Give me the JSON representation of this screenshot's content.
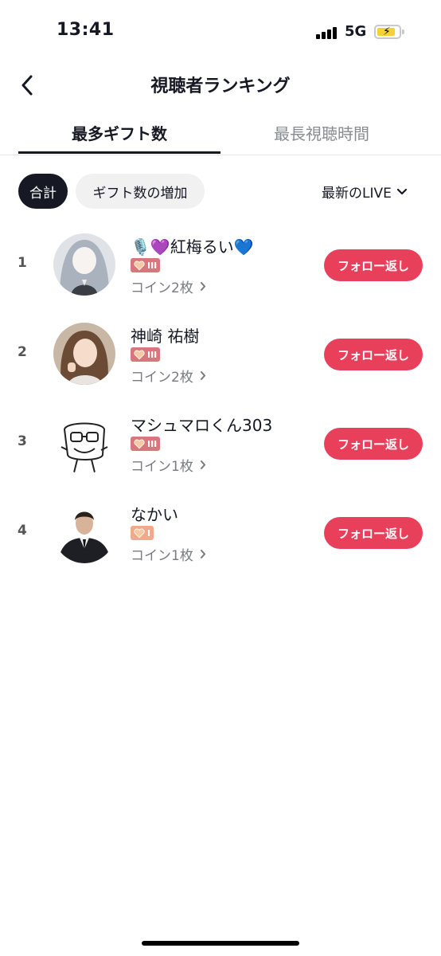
{
  "status_bar": {
    "time": "13:41",
    "network": "5G",
    "battery_icon": "battery-charging-icon",
    "signal_icon": "signal-bars-icon"
  },
  "header": {
    "title": "視聴者ランキング",
    "back_icon": "chevron-left-icon"
  },
  "tabs": [
    {
      "label": "最多ギフト数",
      "active": true
    },
    {
      "label": "最長視聴時間",
      "active": false
    }
  ],
  "filters": {
    "chips": [
      {
        "label": "合計",
        "active": true
      },
      {
        "label": "ギフト数の増加",
        "active": false
      }
    ],
    "live_select": "最新のLIVE"
  },
  "viewers": [
    {
      "rank": "1",
      "name": "🎙️💜紅梅るい💙",
      "badge_level": "III",
      "coins": "コイン2枚",
      "action": "フォロー返し"
    },
    {
      "rank": "2",
      "name": "神崎 祐樹",
      "badge_level": "III",
      "coins": "コイン2枚",
      "action": "フォロー返し"
    },
    {
      "rank": "3",
      "name": "マシュマロくん303",
      "badge_level": "III",
      "coins": "コイン1枚",
      "action": "フォロー返し"
    },
    {
      "rank": "4",
      "name": "なかい",
      "badge_level": "I",
      "coins": "コイン1枚",
      "action": "フォロー返し"
    }
  ],
  "colors": {
    "accent": "#e8405a",
    "badge_high": "#d9767c",
    "badge_low": "#f0a98c",
    "text_primary": "#161823",
    "text_secondary": "#8a8b91"
  }
}
